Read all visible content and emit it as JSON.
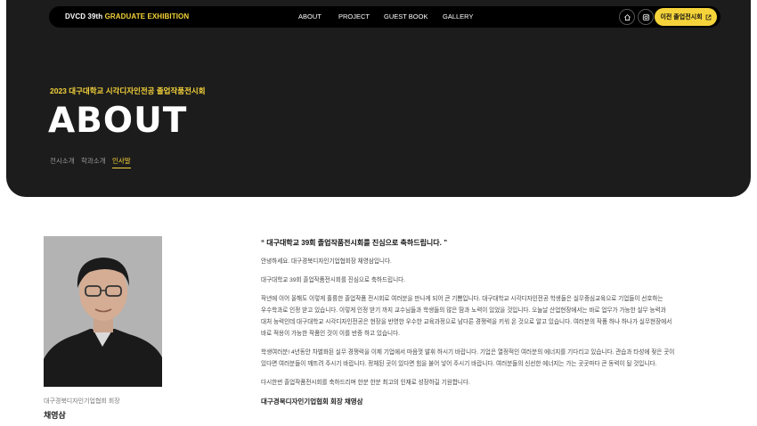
{
  "nav": {
    "brand_prefix": "DVCD 39th",
    "brand_accent": "GRADUATE EXHIBITION",
    "menu": [
      {
        "label": "ABOUT"
      },
      {
        "label": "PROJECT"
      },
      {
        "label": "GUEST BOOK"
      },
      {
        "label": "GALLERY"
      }
    ],
    "prev_exhibition_label": "이전 졸업전시회",
    "icons": [
      "home-icon",
      "instagram-icon",
      "external-link-icon"
    ]
  },
  "hero": {
    "eyebrow": "2023 대구대학교 시각디자인전공 졸업작품전시회",
    "title": "ABOUT",
    "tabs": [
      {
        "label": "전시소개",
        "active": false
      },
      {
        "label": "학과소개",
        "active": false
      },
      {
        "label": "인사말",
        "active": true
      }
    ]
  },
  "author": {
    "role": "대구경북디자인기업협회 회장",
    "name": "채영삼"
  },
  "message": {
    "headline": "“ 대구대학교 39회 졸업작품전시회를 진심으로 축하드립니다. ”",
    "greeting": "안녕하세요. 대구경북디자인기업협회장 채영삼입니다.",
    "congrats": "대구대학교 39회 졸업작품전시회를 진심으로 축하드립니다.",
    "p1": [
      "작년에 이어 올해도 이렇게 훌륭한 졸업작품 전시회로 여러분을 만나게 되어 큰 기쁨입니다. 대구대학교 시각디자인전공 학생들은 실무중심교육으로 기업들이 선호하는",
      "우수학과로 인정 받고 있습니다. 이렇게 인정 받기 까지 교수님들과 학생들의 많은 땀과 노력이 있었을 것입니다. 오늘날 산업현장에서는 바로 업무가 가능한 실무 능력과",
      "대처 능력인데 대구대학교 시각디자인전공은 현장을 반영한 우수한 교육과정으로 남다른 경쟁력을 키워 온 것으로 알고 있습니다. 여러분의 작품 하나 하나가 실무현장에서",
      "바로 적용이 가능한 작품인 것이 이를 반증 하고 있습니다."
    ],
    "p2": [
      "학생여러분! 4년동안 차별화된 실무 경쟁력을 이제 기업에서 마음껏 발휘 하시기 바랍니다. 기업은 열정적인 여러분의 에너지를 기다리고 있습니다. 관습과 타성에 젖은 곳이",
      "있다면 여러분들이 깨뜨려 주시기 바랍니다. 정체된 곳이 있다면 힘을 불어 넣어 주시기 바랍니다. 여러분들의 신선한 에너지는 가는 곳곳마다 큰 동력이 될 것입니다."
    ],
    "closing": "다시한번 졸업작품전시회를 축하드리며 한분 한분 최고의 인재로 성장하길 기원합니다.",
    "signoff": "대구경북디자인기업협회 회장 채영삼"
  },
  "colors": {
    "accent": "#f5d33a",
    "hero_bg": "#1c1c1c",
    "nav_bg": "#000000"
  }
}
